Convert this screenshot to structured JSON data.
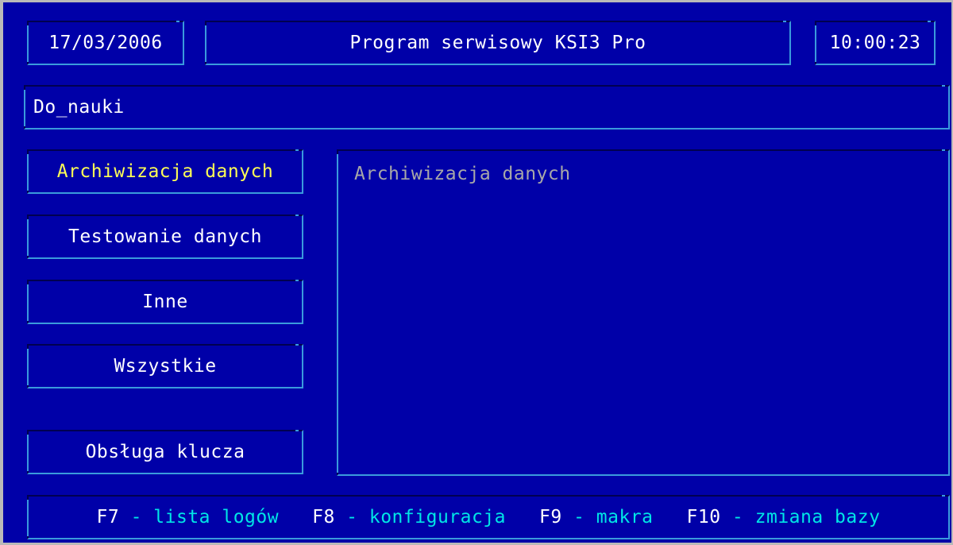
{
  "header": {
    "date": "17/03/2006",
    "title": "Program serwisowy KSI3 Pro",
    "time": "10:00:23"
  },
  "database": {
    "name": "Do_nauki"
  },
  "menu": {
    "items": [
      {
        "label": "Archiwizacja danych",
        "active": true
      },
      {
        "label": "Testowanie danych",
        "active": false
      },
      {
        "label": "Inne",
        "active": false
      },
      {
        "label": "Wszystkie",
        "active": false
      },
      {
        "label": "Obsługa klucza",
        "active": false
      }
    ]
  },
  "panel": {
    "heading": "Archiwizacja danych"
  },
  "footer": {
    "keys": [
      {
        "key": "F7",
        "separator": " - ",
        "description": "lista logów"
      },
      {
        "key": "F8",
        "separator": " - ",
        "description": "konfiguracja"
      },
      {
        "key": "F9",
        "separator": " - ",
        "description": "makra"
      },
      {
        "key": "F10",
        "separator": " - ",
        "description": "zmiana bazy"
      }
    ]
  },
  "colors": {
    "background": "#0000a8",
    "text": "#ffffff",
    "active_item": "#ffff55",
    "function_key_description": "#00e6e6",
    "panel_text": "#a8a8a8",
    "frame_light": "#3a9adc",
    "frame_dark": "#000050"
  }
}
